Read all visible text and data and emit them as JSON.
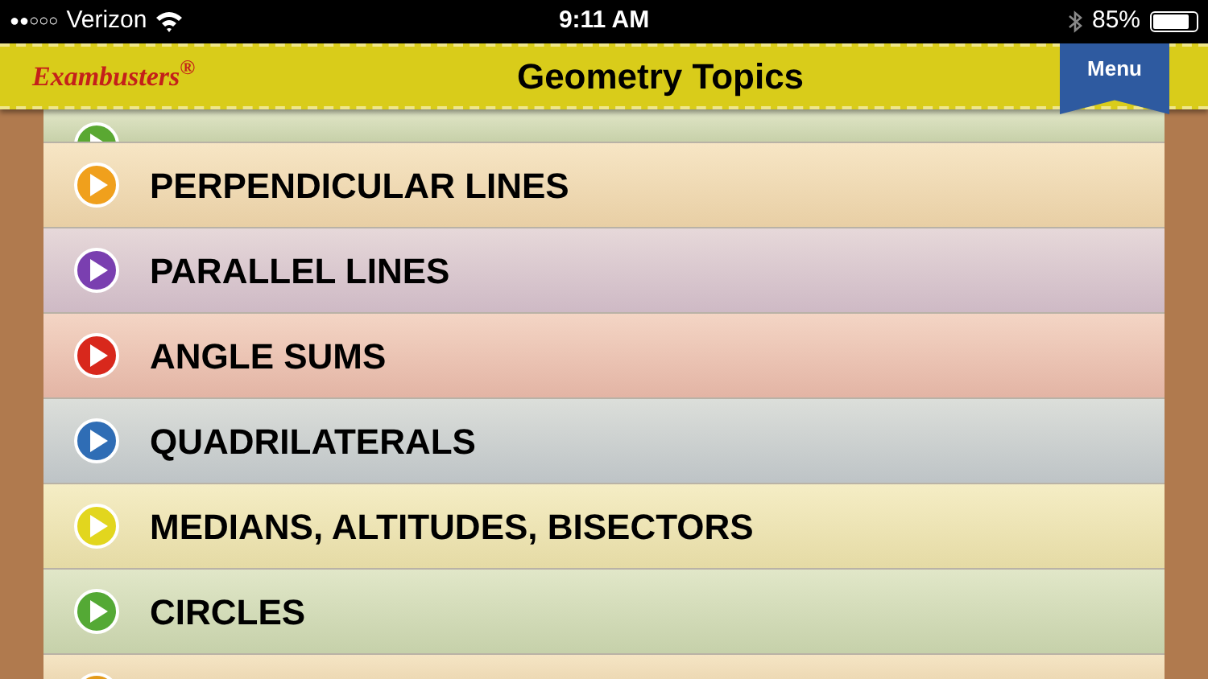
{
  "status_bar": {
    "signal_bars": "●●○○○",
    "carrier": "Verizon",
    "time": "9:11 AM",
    "battery": "85%"
  },
  "header": {
    "logo": "Exambusters",
    "logo_mark": "®",
    "title": "Geometry Topics",
    "menu_button": "Menu"
  },
  "topics": [
    {
      "color": "#5aa832"
    },
    {
      "label": "PERPENDICULAR LINES",
      "color": "#f0a01c"
    },
    {
      "label": "PARALLEL LINES",
      "color": "#7a3fb0"
    },
    {
      "label": "ANGLE SUMS",
      "color": "#d8281c"
    },
    {
      "label": "QUADRILATERALS",
      "color": "#2f6db5"
    },
    {
      "label": "MEDIANS, ALTITUDES, BISECTORS",
      "color": "#e2d61e"
    },
    {
      "label": "CIRCLES",
      "color": "#54a935"
    },
    {
      "color": "#e39a1a"
    }
  ]
}
